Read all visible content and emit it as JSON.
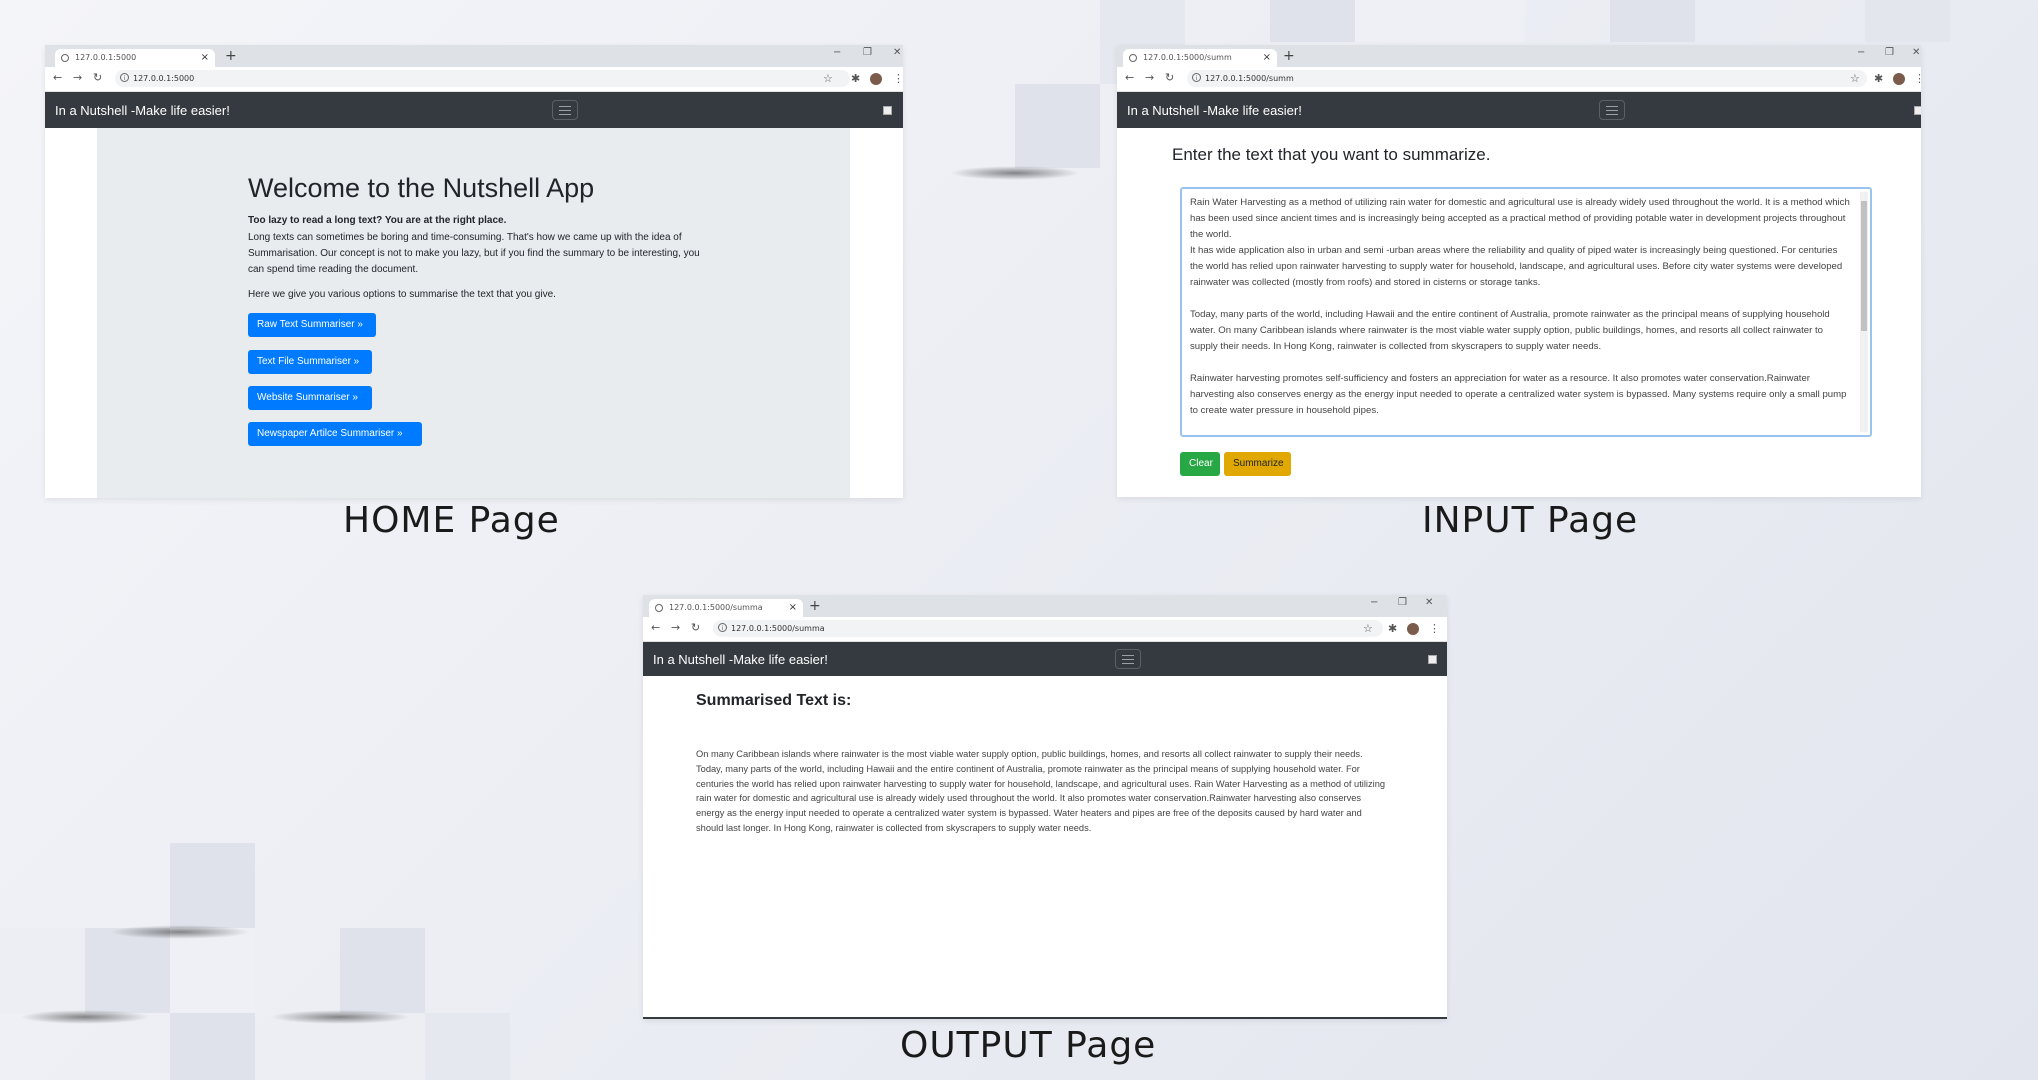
{
  "captions": {
    "home": "HOME Page",
    "input": "INPUT Page",
    "output": "OUTPUT Page"
  },
  "app": {
    "brand": "In a Nutshell -Make life easier!"
  },
  "home": {
    "tab_title": "127.0.0.1:5000",
    "url": "127.0.0.1:5000",
    "heading": "Welcome to the Nutshell App",
    "lead_bold": "Too lazy to read a long text? You are at the right place.",
    "paragraph": "Long texts can sometimes be boring and time-consuming. That's how we came up with the idea of Summarisation. Our concept is not to make you lazy, but if you find the summary to be interesting, you can spend time reading the document.",
    "options_intro": "Here we give you various options to summarise the text that you give.",
    "buttons": [
      "Raw Text Summariser »",
      "Text File Summariser »",
      "Website Summariser »",
      "Newspaper Artilce Summariser »"
    ]
  },
  "input": {
    "tab_title": "127.0.0.1:5000/summ",
    "url": "127.0.0.1:5000/summ",
    "heading": "Enter the text that you want to summarize.",
    "text": "Rain Water Harvesting as a method of utilizing rain water for domestic and agricultural use is already widely used throughout the world. It is a method which has been used since ancient times and is increasingly being accepted as a practical method of providing potable water in development projects throughout the world.\nIt has wide application also in urban and semi -urban areas where the reliability and quality of piped water is increasingly being questioned. For centuries the world has relied upon rainwater harvesting to supply water for household, landscape, and agricultural uses. Before city water systems were developed rainwater was collected (mostly from roofs) and stored in cisterns or storage tanks.\n\nToday, many parts of the world, including Hawaii and the entire continent of Australia, promote rainwater as the principal means of supplying household water. On many Caribbean islands where rainwater is the most viable water supply option, public buildings, homes, and resorts all collect rainwater to supply their needs. In Hong Kong, rainwater is collected from skyscrapers to supply water needs.\n\nRainwater harvesting promotes self-sufficiency and fosters an appreciation for water as a resource. It also promotes water conservation.Rainwater harvesting also conserves energy as the energy input needed to operate a centralized water system is bypassed. Many systems require only a small pump to create water pressure in household pipes.",
    "clear_label": "Clear",
    "summarize_label": "Summarize",
    "colors": {
      "clear": "#28a745",
      "summarize": "#e0a800"
    }
  },
  "output": {
    "tab_title": "127.0.0.1:5000/summa",
    "url": "127.0.0.1:5000/summa",
    "heading": "Summarised Text is:",
    "summary": "On many Caribbean islands where rainwater is the most viable water supply option, public buildings, homes, and resorts all collect rainwater to supply their needs. Today, many parts of the world, including Hawaii and the entire continent of Australia, promote rainwater as the principal means of supplying household water. For centuries the world has relied upon rainwater harvesting to supply water for household, landscape, and agricultural uses. Rain Water Harvesting as a method of utilizing rain water for domestic and agricultural use is already widely used throughout the world. It also promotes water conservation.Rainwater harvesting also conserves energy as the energy input needed to operate a centralized water system is bypassed. Water heaters and pipes are free of the deposits caused by hard water and should last longer. In Hong Kong, rainwater is collected from skyscrapers to supply water needs."
  },
  "colors": {
    "navbar": "#343a40",
    "primary": "#007bff",
    "jumbotron": "#e9ecef"
  },
  "icons": {
    "tab_close": "×",
    "new_tab": "+",
    "back": "←",
    "forward": "→",
    "reload": "↻",
    "star": "☆",
    "extensions": "✱",
    "menu": "⋮",
    "minimize": "−",
    "restore": "❐",
    "window_close": "✕",
    "info": "i"
  }
}
